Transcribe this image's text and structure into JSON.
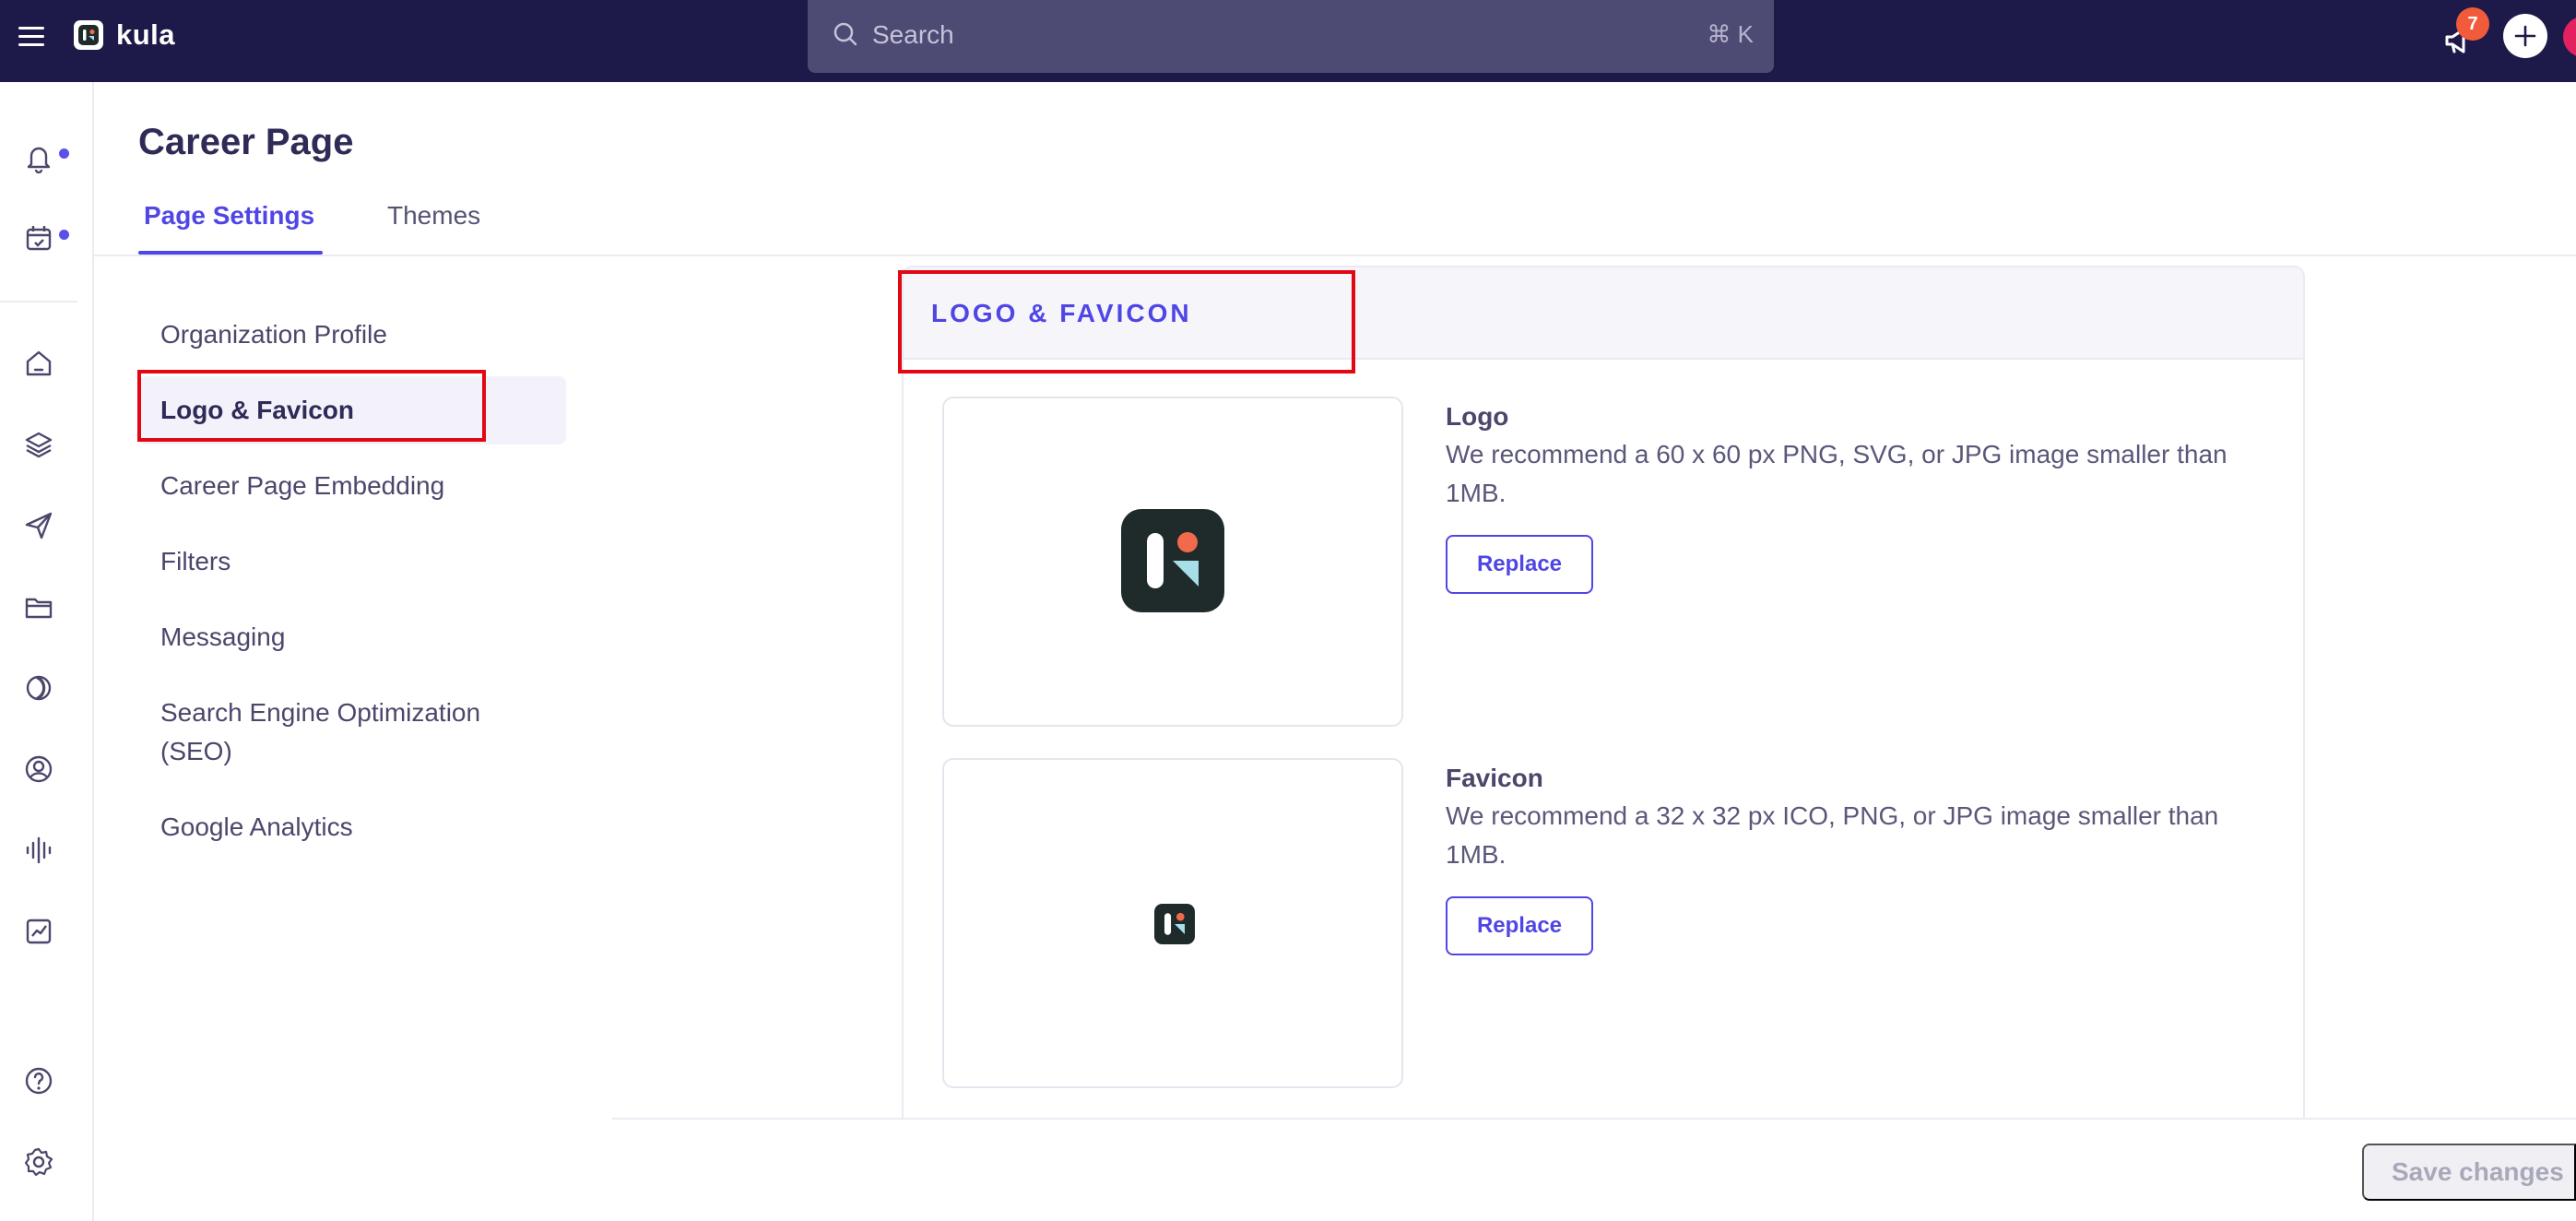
{
  "app": {
    "name": "kula",
    "search_placeholder": "Search",
    "search_shortcut": "⌘ K",
    "notification_count": "7"
  },
  "icons": {
    "menu": "hamburger-icon",
    "search": "search-icon",
    "announcements": "megaphone-icon",
    "add": "plus-icon",
    "rail": [
      "bell-icon",
      "calendar-check-icon",
      "home-icon",
      "layers-icon",
      "send-icon",
      "folder-icon",
      "circle-half-icon",
      "user-circle-icon",
      "waveform-icon",
      "chart-icon",
      "help-icon",
      "gear-icon"
    ]
  },
  "header": {
    "title": "Career Page",
    "tabs": [
      {
        "label": "Page Settings",
        "active": true
      },
      {
        "label": "Themes",
        "active": false
      }
    ]
  },
  "subnav": {
    "items": [
      {
        "label": "Organization Profile"
      },
      {
        "label": "Logo & Favicon",
        "active": true
      },
      {
        "label": "Career Page Embedding"
      },
      {
        "label": "Filters"
      },
      {
        "label": "Messaging"
      },
      {
        "label": "Search Engine Optimization (SEO)"
      },
      {
        "label": "Google Analytics"
      }
    ]
  },
  "card": {
    "title": "LOGO & FAVICON",
    "logo": {
      "title": "Logo",
      "description": "We recommend a 60 x 60 px PNG, SVG, or JPG image smaller than 1MB.",
      "button": "Replace"
    },
    "favicon": {
      "title": "Favicon",
      "description": "We recommend a 32 x 32 px ICO, PNG, or JPG image smaller than 1MB.",
      "button": "Replace"
    }
  },
  "footer": {
    "save_label": "Save changes"
  },
  "colors": {
    "topbar": "#1d1a4a",
    "accent": "#4f46e5",
    "badge": "#f15a3a",
    "highlight": "#e30613"
  }
}
